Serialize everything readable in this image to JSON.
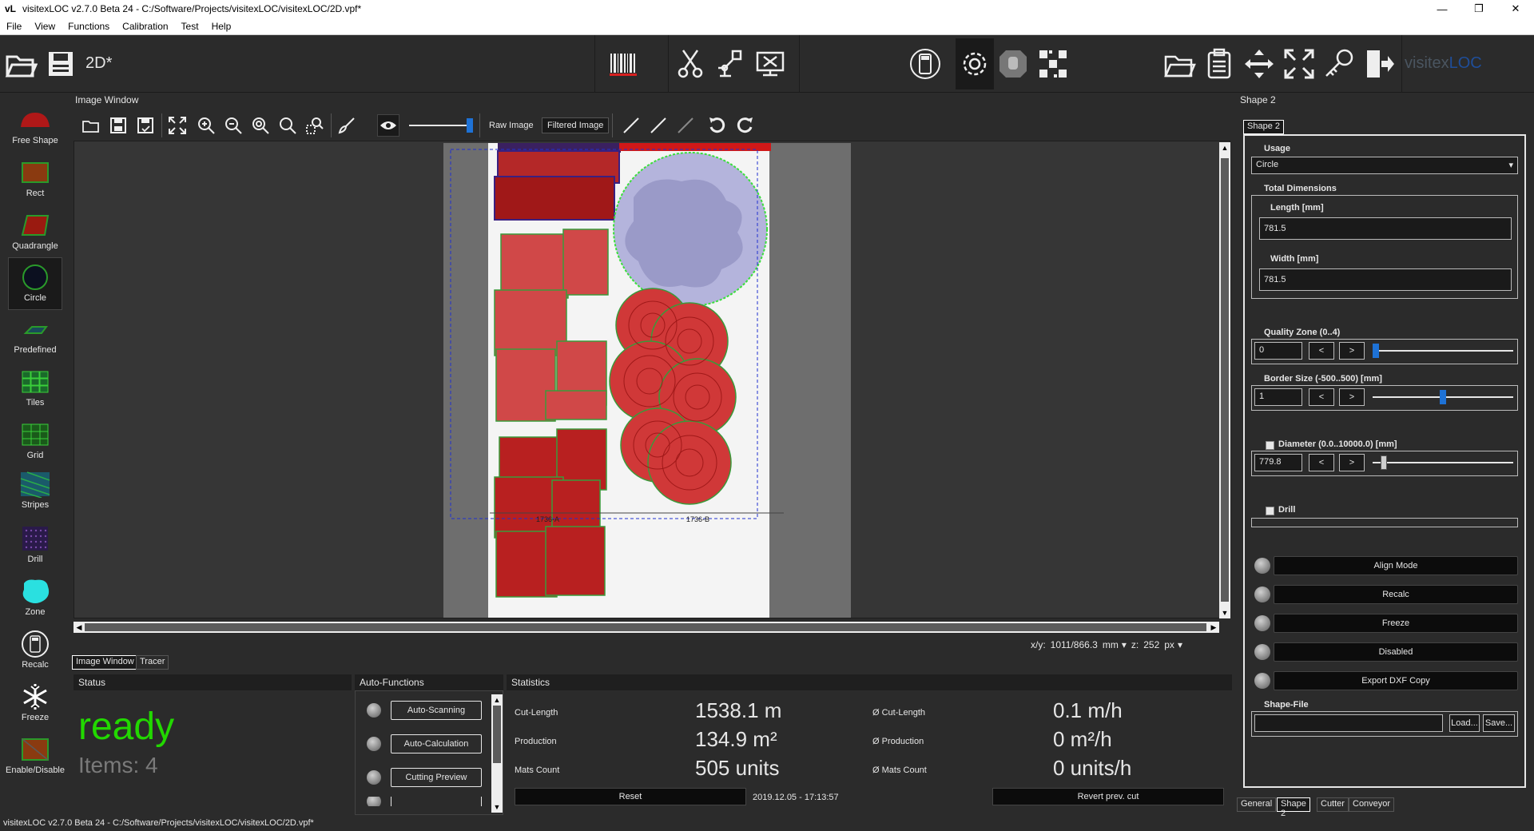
{
  "window": {
    "logo": "vL",
    "title": "visitexLOC v2.7.0 Beta 24 - C:/Software/Projects/visitexLOC/visitexLOC/2D.vpf*",
    "minimize": "—",
    "maximize": "❐",
    "close": "✕"
  },
  "menu": [
    "File",
    "View",
    "Functions",
    "Calibration",
    "Test",
    "Help"
  ],
  "toolbar": {
    "file_name": "2D*",
    "brand_left": "visitex",
    "brand_right": "LOC"
  },
  "palette": [
    {
      "label": "Free Shape",
      "icon": "free-shape-icon"
    },
    {
      "label": "Rect",
      "icon": "rect-icon"
    },
    {
      "label": "Quadrangle",
      "icon": "quadrangle-icon"
    },
    {
      "label": "Circle",
      "icon": "circle-icon",
      "selected": true
    },
    {
      "label": "Predefined",
      "icon": "predefined-icon"
    },
    {
      "label": "Tiles",
      "icon": "tiles-icon"
    },
    {
      "label": "Grid",
      "icon": "grid-icon"
    },
    {
      "label": "Stripes",
      "icon": "stripes-icon"
    },
    {
      "label": "Drill",
      "icon": "drill-icon"
    },
    {
      "label": "Zone",
      "icon": "zone-icon"
    },
    {
      "label": "Recalc",
      "icon": "calculator-icon"
    },
    {
      "label": "Freeze",
      "icon": "snowflake-icon"
    },
    {
      "label": "Enable/Disable",
      "icon": "enable-disable-icon"
    }
  ],
  "image_window": {
    "title": "Image Window",
    "raw_image": "Raw Image",
    "filtered_image": "Filtered Image",
    "label_a": "1736-A",
    "label_b": "1736-B"
  },
  "coords": {
    "xy_label": "x/y:",
    "xy_value": "1011/866.3",
    "unit_xy": "mm",
    "z_label": "z:",
    "z_value": "252",
    "unit_z": "px"
  },
  "bottom_tabs": [
    "Image Window",
    "Tracer"
  ],
  "status": {
    "header": "Status",
    "state": "ready",
    "items": "Items: 4"
  },
  "auto_functions": {
    "header": "Auto-Functions",
    "buttons": [
      "Auto-Scanning",
      "Auto-Calculation",
      "Cutting Preview"
    ]
  },
  "statistics": {
    "header": "Statistics",
    "rows": [
      {
        "label": "Cut-Length",
        "value": "1538.1 m",
        "avg_label": "Ø Cut-Length",
        "avg_value": "0.1 m/h"
      },
      {
        "label": "Production",
        "value": "134.9 m²",
        "avg_label": "Ø Production",
        "avg_value": "0 m²/h"
      },
      {
        "label": "Mats Count",
        "value": "505 units",
        "avg_label": "Ø Mats Count",
        "avg_value": "0 units/h"
      }
    ],
    "reset": "Reset",
    "timestamp": "2019.12.05 - 17:13:57",
    "revert": "Revert prev. cut"
  },
  "right_panel": {
    "title": "Shape 2",
    "tab": "Shape 2",
    "usage_label": "Usage",
    "usage_value": "Circle",
    "total_dimensions": "Total Dimensions",
    "length_label": "Length [mm]",
    "length_value": "781.5",
    "width_label": "Width [mm]",
    "width_value": "781.5",
    "quality_label": "Quality Zone (0..4)",
    "quality_value": "0",
    "border_label": "Border Size (-500..500) [mm]",
    "border_value": "1",
    "diameter_label": "Diameter (0.0..10000.0) [mm]",
    "diameter_value": "779.8",
    "drill_label": "Drill",
    "step_prev": "<",
    "step_next": ">",
    "buttons": [
      "Align Mode",
      "Recalc",
      "Freeze",
      "Disabled",
      "Export DXF Copy"
    ],
    "shape_file_label": "Shape-File",
    "load": "Load...",
    "save": "Save...",
    "bottom_tabs": [
      "General",
      "Shape 2",
      "Cutter",
      "Conveyor"
    ]
  },
  "statusbar": "visitexLOC v2.7.0 Beta 24 - C:/Software/Projects/visitexLOC/visitexLOC/2D.vpf*"
}
